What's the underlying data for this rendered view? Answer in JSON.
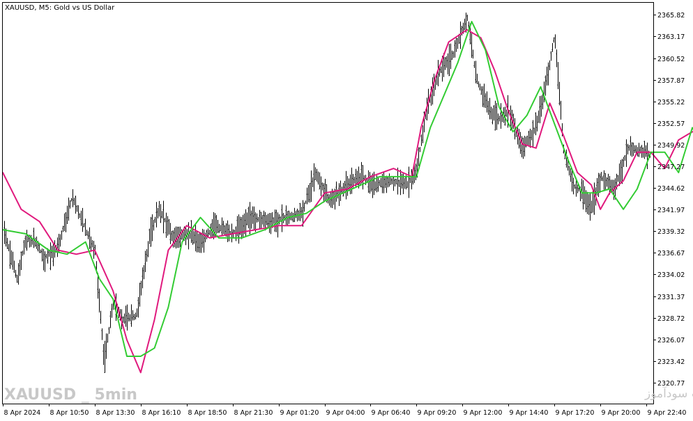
{
  "header": {
    "title": "XAUUSD, M5:  Gold vs US Dollar"
  },
  "watermark": {
    "left": "XAUUSD _ 5min",
    "right": "انتشار در سایت سودآموز"
  },
  "colors": {
    "bars": "#000000",
    "slow_ma": "#e0197d",
    "fast_ma": "#33cc33",
    "axis": "#000000",
    "background": "#ffffff"
  },
  "chart_data": {
    "type": "line",
    "title": "XAUUSD, M5:  Gold vs US Dollar",
    "xlabel": "",
    "ylabel": "",
    "ylim": [
      2318.2,
      2367.3
    ],
    "grid": false,
    "y_ticks": [
      2365.82,
      2363.17,
      2360.52,
      2357.87,
      2355.22,
      2352.57,
      2349.92,
      2347.27,
      2344.62,
      2341.97,
      2339.32,
      2336.67,
      2334.02,
      2331.37,
      2328.72,
      2326.07,
      2323.42,
      2320.77
    ],
    "x_ticks": [
      "8 Apr 2024",
      "8 Apr 10:50",
      "8 Apr 13:30",
      "8 Apr 16:10",
      "8 Apr 18:50",
      "8 Apr 21:30",
      "9 Apr 01:20",
      "9 Apr 04:00",
      "9 Apr 06:40",
      "9 Apr 09:20",
      "9 Apr 12:00",
      "9 Apr 14:40",
      "9 Apr 17:20",
      "9 Apr 20:00",
      "9 Apr 22:40"
    ],
    "price_path": [
      [
        0,
        2340.0
      ],
      [
        0.3,
        2333.5
      ],
      [
        0.5,
        2338.5
      ],
      [
        0.7,
        2338.0
      ],
      [
        0.9,
        2336.0
      ],
      [
        1.2,
        2337.5
      ],
      [
        1.5,
        2343.5
      ],
      [
        1.8,
        2339.5
      ],
      [
        2.0,
        2337.0
      ],
      [
        2.2,
        2323.5
      ],
      [
        2.4,
        2330.5
      ],
      [
        2.6,
        2328.5
      ],
      [
        2.9,
        2329.0
      ],
      [
        3.2,
        2339.0
      ],
      [
        3.4,
        2342.0
      ],
      [
        3.7,
        2338.5
      ],
      [
        4.0,
        2339.0
      ],
      [
        4.3,
        2338.0
      ],
      [
        4.6,
        2340.0
      ],
      [
        5.0,
        2339.0
      ],
      [
        5.4,
        2341.0
      ],
      [
        5.8,
        2340.5
      ],
      [
        6.2,
        2341.0
      ],
      [
        6.5,
        2341.5
      ],
      [
        6.8,
        2346.5
      ],
      [
        7.1,
        2343.0
      ],
      [
        7.4,
        2344.5
      ],
      [
        7.6,
        2345.5
      ],
      [
        7.8,
        2346.0
      ],
      [
        8.1,
        2345.0
      ],
      [
        8.4,
        2345.5
      ],
      [
        8.8,
        2345.0
      ],
      [
        9.0,
        2347.0
      ],
      [
        9.2,
        2354.0
      ],
      [
        9.5,
        2359.0
      ],
      [
        9.8,
        2361.0
      ],
      [
        10.1,
        2365.5
      ],
      [
        10.3,
        2358.0
      ],
      [
        10.6,
        2354.0
      ],
      [
        10.8,
        2353.0
      ],
      [
        11.0,
        2354.0
      ],
      [
        11.3,
        2349.5
      ],
      [
        11.6,
        2352.0
      ],
      [
        11.9,
        2360.0
      ],
      [
        12.0,
        2363.5
      ],
      [
        12.2,
        2349.0
      ],
      [
        12.4,
        2345.0
      ],
      [
        12.6,
        2344.0
      ],
      [
        12.8,
        2342.0
      ],
      [
        13.0,
        2346.0
      ],
      [
        13.3,
        2344.5
      ],
      [
        13.6,
        2349.5
      ],
      [
        14.0,
        2349.0
      ],
      [
        14.3,
        2347.0
      ],
      [
        14.5,
        2350.0
      ],
      [
        14.8,
        2353.5
      ],
      [
        15.0,
        2351.5
      ],
      [
        15.1,
        2353.0
      ]
    ],
    "series": [
      {
        "name": "",
        "x": [
          0,
          0.4,
          0.8,
          1.2,
          1.6,
          2.0,
          2.4,
          2.7,
          3.0,
          3.3,
          3.6,
          4.0,
          4.5,
          5.0,
          5.5,
          6.0,
          6.5,
          7.0,
          7.5,
          8.0,
          8.5,
          8.9,
          9.1,
          9.4,
          9.7,
          10.1,
          10.4,
          10.7,
          11.0,
          11.3,
          11.6,
          11.9,
          12.2,
          12.5,
          12.8,
          13.0,
          13.2,
          13.5,
          13.8,
          14.1,
          14.4,
          14.7,
          15.0,
          15.1
        ],
        "y": [
          2346.5,
          2342.0,
          2340.5,
          2337.0,
          2336.5,
          2337.0,
          2332.0,
          2326.0,
          2322.0,
          2328.5,
          2337.0,
          2340.0,
          2338.5,
          2339.0,
          2339.5,
          2340.0,
          2340.0,
          2344.0,
          2344.5,
          2346.0,
          2347.0,
          2346.0,
          2352.0,
          2358.0,
          2362.5,
          2364.0,
          2363.0,
          2359.0,
          2354.0,
          2350.0,
          2349.5,
          2355.0,
          2351.0,
          2346.5,
          2345.0,
          2342.0,
          2344.0,
          2345.5,
          2349.0,
          2349.0,
          2347.0,
          2350.5,
          2351.5,
          2351.5
        ]
      },
      {
        "name": "",
        "x": [
          0,
          0.5,
          1.0,
          1.4,
          1.8,
          2.1,
          2.4,
          2.7,
          3.0,
          3.3,
          3.6,
          3.9,
          4.3,
          4.7,
          5.2,
          5.7,
          6.2,
          6.6,
          7.0,
          7.4,
          7.8,
          8.2,
          8.6,
          9.0,
          9.3,
          9.6,
          9.9,
          10.2,
          10.5,
          10.8,
          11.1,
          11.4,
          11.7,
          12.0,
          12.3,
          12.6,
          12.9,
          13.2,
          13.5,
          13.8,
          14.1,
          14.4,
          14.7,
          15.0,
          15.1
        ],
        "y": [
          2339.5,
          2339.0,
          2337.0,
          2336.5,
          2338.0,
          2333.5,
          2331.0,
          2324.0,
          2324.0,
          2325.0,
          2330.0,
          2338.0,
          2341.0,
          2338.5,
          2338.5,
          2339.5,
          2341.0,
          2341.5,
          2343.0,
          2344.0,
          2345.0,
          2346.0,
          2346.0,
          2346.0,
          2352.0,
          2356.0,
          2360.0,
          2365.0,
          2361.5,
          2354.5,
          2351.5,
          2353.5,
          2357.0,
          2352.5,
          2348.0,
          2344.0,
          2344.0,
          2344.5,
          2342.0,
          2344.5,
          2349.0,
          2349.0,
          2346.5,
          2352.0,
          2351.0
        ]
      }
    ]
  }
}
